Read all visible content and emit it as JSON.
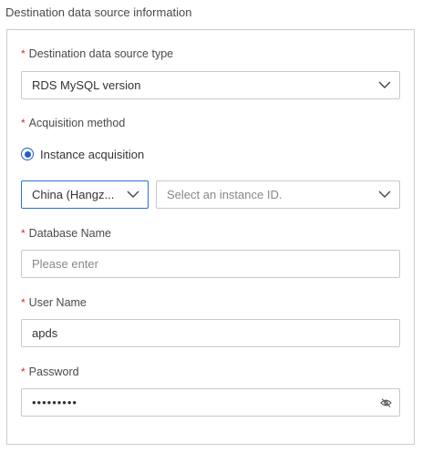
{
  "section": {
    "title": "Destination data source information"
  },
  "form": {
    "required_mark": "*",
    "source_type": {
      "label": "Destination data source type",
      "value": "RDS MySQL version"
    },
    "acquisition": {
      "label": "Acquisition method",
      "option": "Instance acquisition",
      "selected": true
    },
    "region": {
      "value": "China (Hangz..."
    },
    "instance": {
      "placeholder": "Select an instance ID."
    },
    "database": {
      "label": "Database Name",
      "placeholder": "Please enter"
    },
    "username": {
      "label": "User Name",
      "value": "apds"
    },
    "password": {
      "label": "Password",
      "value": "•••••••••"
    }
  },
  "icons": {
    "dropdown": "chevron-down-icon",
    "password_toggle": "eye-slash-icon",
    "accent": "#1f5fcf",
    "required": "#e0272b"
  }
}
